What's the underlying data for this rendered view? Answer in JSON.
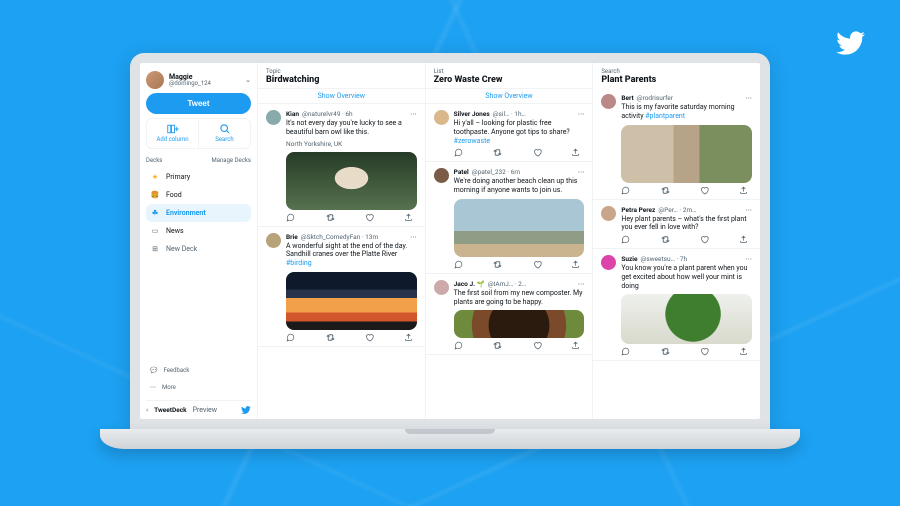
{
  "brand": {
    "name": "Twitter"
  },
  "account": {
    "name": "Maggie",
    "handle": "@domingo_124"
  },
  "compose": {
    "tweet_label": "Tweet",
    "add_column_label": "Add column",
    "search_label": "Search"
  },
  "decks": {
    "header": "Decks",
    "manage_label": "Manage Decks",
    "items": [
      {
        "label": "Primary"
      },
      {
        "label": "Food"
      },
      {
        "label": "Environment"
      },
      {
        "label": "News"
      },
      {
        "label": "New Deck"
      }
    ]
  },
  "footer": {
    "feedback": "Feedback",
    "more": "More",
    "collapse": "‹",
    "brand": "TweetDeck",
    "preview": "Preview"
  },
  "columns": [
    {
      "kind": "Topic",
      "title": "Birdwatching",
      "overview": "Show Overview",
      "tweets": [
        {
          "name": "Kian",
          "handle": "@naturelvr49",
          "time": "6h",
          "text": "It's not every day you're lucky to see a beautiful barn owl like this.",
          "location": "North Yorkshire, UK",
          "avatar": "#8aa",
          "img": "owl"
        },
        {
          "name": "Brie",
          "handle": "@Sktch_ComedyFan",
          "time": "13m",
          "text": "A wonderful sight at the end of the day. Sandhill cranes over the Platte River",
          "hashtag": "#birding",
          "avatar": "#b7a27a",
          "img": "sunset"
        }
      ]
    },
    {
      "kind": "List",
      "title": "Zero Waste Crew",
      "overview": "Show Overview",
      "tweets": [
        {
          "name": "Silver Jones",
          "handle": "@sil…",
          "time": "1h…",
          "text": "Hi y'all – looking for plastic free toothpaste. Anyone got tips to share?",
          "hashtag": "#zerowaste",
          "avatar": "#d9b98c"
        },
        {
          "name": "Patel",
          "handle": "@patel_232",
          "time": "6m",
          "text": "We're doing another beach clean up this morning if anyone wants to join us.",
          "avatar": "#7a5c46",
          "img": "beach"
        },
        {
          "name": "Jaco J. 🌱",
          "handle": "@IAmJ…",
          "time": "2…",
          "text": "The first soil from my new composter. My plants are going to be happy.",
          "avatar": "#caa",
          "img": "soil"
        }
      ]
    },
    {
      "kind": "Search",
      "title": "Plant Parents",
      "tweets": [
        {
          "name": "Bert",
          "handle": "@rodrisurfer",
          "time": "",
          "text": "This is my favorite saturday morning activity",
          "hashtag": "#plantparent",
          "avatar": "#b88",
          "img": "plantroom"
        },
        {
          "name": "Petra Perez",
          "handle": "@Per…",
          "time": "2m…",
          "text": "Hey plant parents – what's the first plant you ever fell in love with?",
          "avatar": "#c9a58a"
        },
        {
          "name": "Suzie",
          "handle": "@sweetsu…",
          "time": "7h",
          "text": "You know you're a plant parent when you get excited about how well your mint is doing",
          "avatar": "#d4a",
          "img": "mint"
        }
      ]
    }
  ]
}
